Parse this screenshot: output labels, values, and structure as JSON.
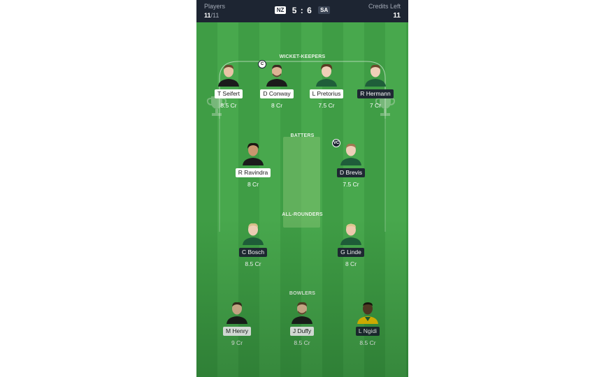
{
  "header": {
    "players_label": "Players",
    "players_count": "11",
    "players_total": "/11",
    "team1": "NZ",
    "score": "5 : 6",
    "team2": "SA",
    "credits_label": "Credits Left",
    "credits_value": "11"
  },
  "sections": {
    "wicketkeepers": "WICKET-KEEPERS",
    "batters": "BATTERS",
    "allrounders": "ALL-ROUNDERS",
    "bowlers": "BOWLERS"
  },
  "players": {
    "seifert": {
      "name": "T Seifert",
      "credits": "8.5 Cr",
      "team": "NZ"
    },
    "conway": {
      "name": "D Conway",
      "credits": "8 Cr",
      "team": "NZ",
      "role_badge": "C"
    },
    "pretorius": {
      "name": "L Pretorius",
      "credits": "7.5 Cr",
      "team": "SA"
    },
    "hermann": {
      "name": "R Hermann",
      "credits": "7 Cr",
      "team": "SA"
    },
    "ravindra": {
      "name": "R Ravindra",
      "credits": "8 Cr",
      "team": "NZ"
    },
    "brevis": {
      "name": "D Brevis",
      "credits": "7.5 Cr",
      "team": "SA",
      "role_badge": "VC"
    },
    "bosch": {
      "name": "C Bosch",
      "credits": "8.5 Cr",
      "team": "SA"
    },
    "linde": {
      "name": "G Linde",
      "credits": "8 Cr",
      "team": "SA"
    },
    "henry": {
      "name": "M Henry",
      "credits": "9 Cr",
      "team": "NZ"
    },
    "duffy": {
      "name": "J Duffy",
      "credits": "8.5 Cr",
      "team": "NZ"
    },
    "ngidi": {
      "name": "L Ngidi",
      "credits": "8.5 Cr",
      "team": "SA"
    }
  },
  "colors": {
    "topbar": "#1d2532",
    "field_green": "#43a349",
    "nz_kit": "#1b1b1b",
    "sa_kit": "#1f5e3a",
    "sa_alt_kit": "#f2c400"
  }
}
